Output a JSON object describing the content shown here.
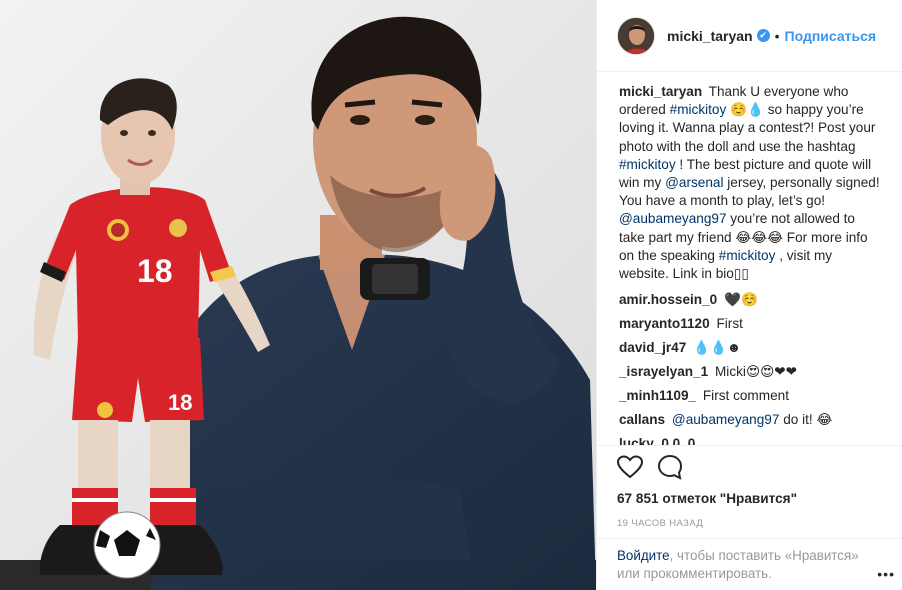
{
  "post": {
    "username": "micki_taryan",
    "follow_label": "Подписаться",
    "dot": "•",
    "verified_glyph": "✔",
    "avatar_icon": "profile-avatar"
  },
  "caption": {
    "user": "micki_taryan",
    "parts": [
      {
        "t": "Thank U everyone who ordered ",
        "k": "text"
      },
      {
        "t": "#mickitoy",
        "k": "tag"
      },
      {
        "t": " ☺️💧 so happy you’re loving it. Wanna play a contest?! Post your photo with the doll and use the hashtag ",
        "k": "text"
      },
      {
        "t": "#mickitoy",
        "k": "tag"
      },
      {
        "t": " ! The best picture and quote will win my ",
        "k": "text"
      },
      {
        "t": "@arsenal",
        "k": "tag"
      },
      {
        "t": " jersey, personally signed! You have a month to play, let’s go! ",
        "k": "text"
      },
      {
        "t": "@aubameyang97",
        "k": "tag"
      },
      {
        "t": " you’re not allowed to take part my friend 😂😂😂 For more info on the speaking ",
        "k": "text"
      },
      {
        "t": "#mickitoy",
        "k": "tag"
      },
      {
        "t": " , visit my website. Link in bio▯▯",
        "k": "text"
      }
    ]
  },
  "comments": [
    {
      "user": "amir.hossein_0",
      "text": "🖤☺️"
    },
    {
      "user": "maryanto1120",
      "text": "First"
    },
    {
      "user": "david_jr47",
      "text": "💧💧☻"
    },
    {
      "user": "_israyelyan_1",
      "text": "Micki😍😍❤❤"
    },
    {
      "user": "_minh1109_",
      "text": "First comment"
    },
    {
      "user": "callans",
      "text": "do it! 😂",
      "mention": "@aubameyang97"
    },
    {
      "user": "lucky_0.0_0",
      "text": "..."
    }
  ],
  "actions": {
    "heart_icon": "heart-icon",
    "comment_icon": "comment-icon",
    "likes_text": "67 851 отметок \"Нравится\"",
    "time_text": "19 часов назад"
  },
  "login": {
    "link_text": "Войдите",
    "rest_text": ", чтобы поставить «Нравится» или прокомментировать.",
    "more_icon": "•••"
  },
  "colors": {
    "accent": "#3897f0",
    "tag": "#003569",
    "muted": "#999999",
    "jersey_red": "#d8232a"
  }
}
